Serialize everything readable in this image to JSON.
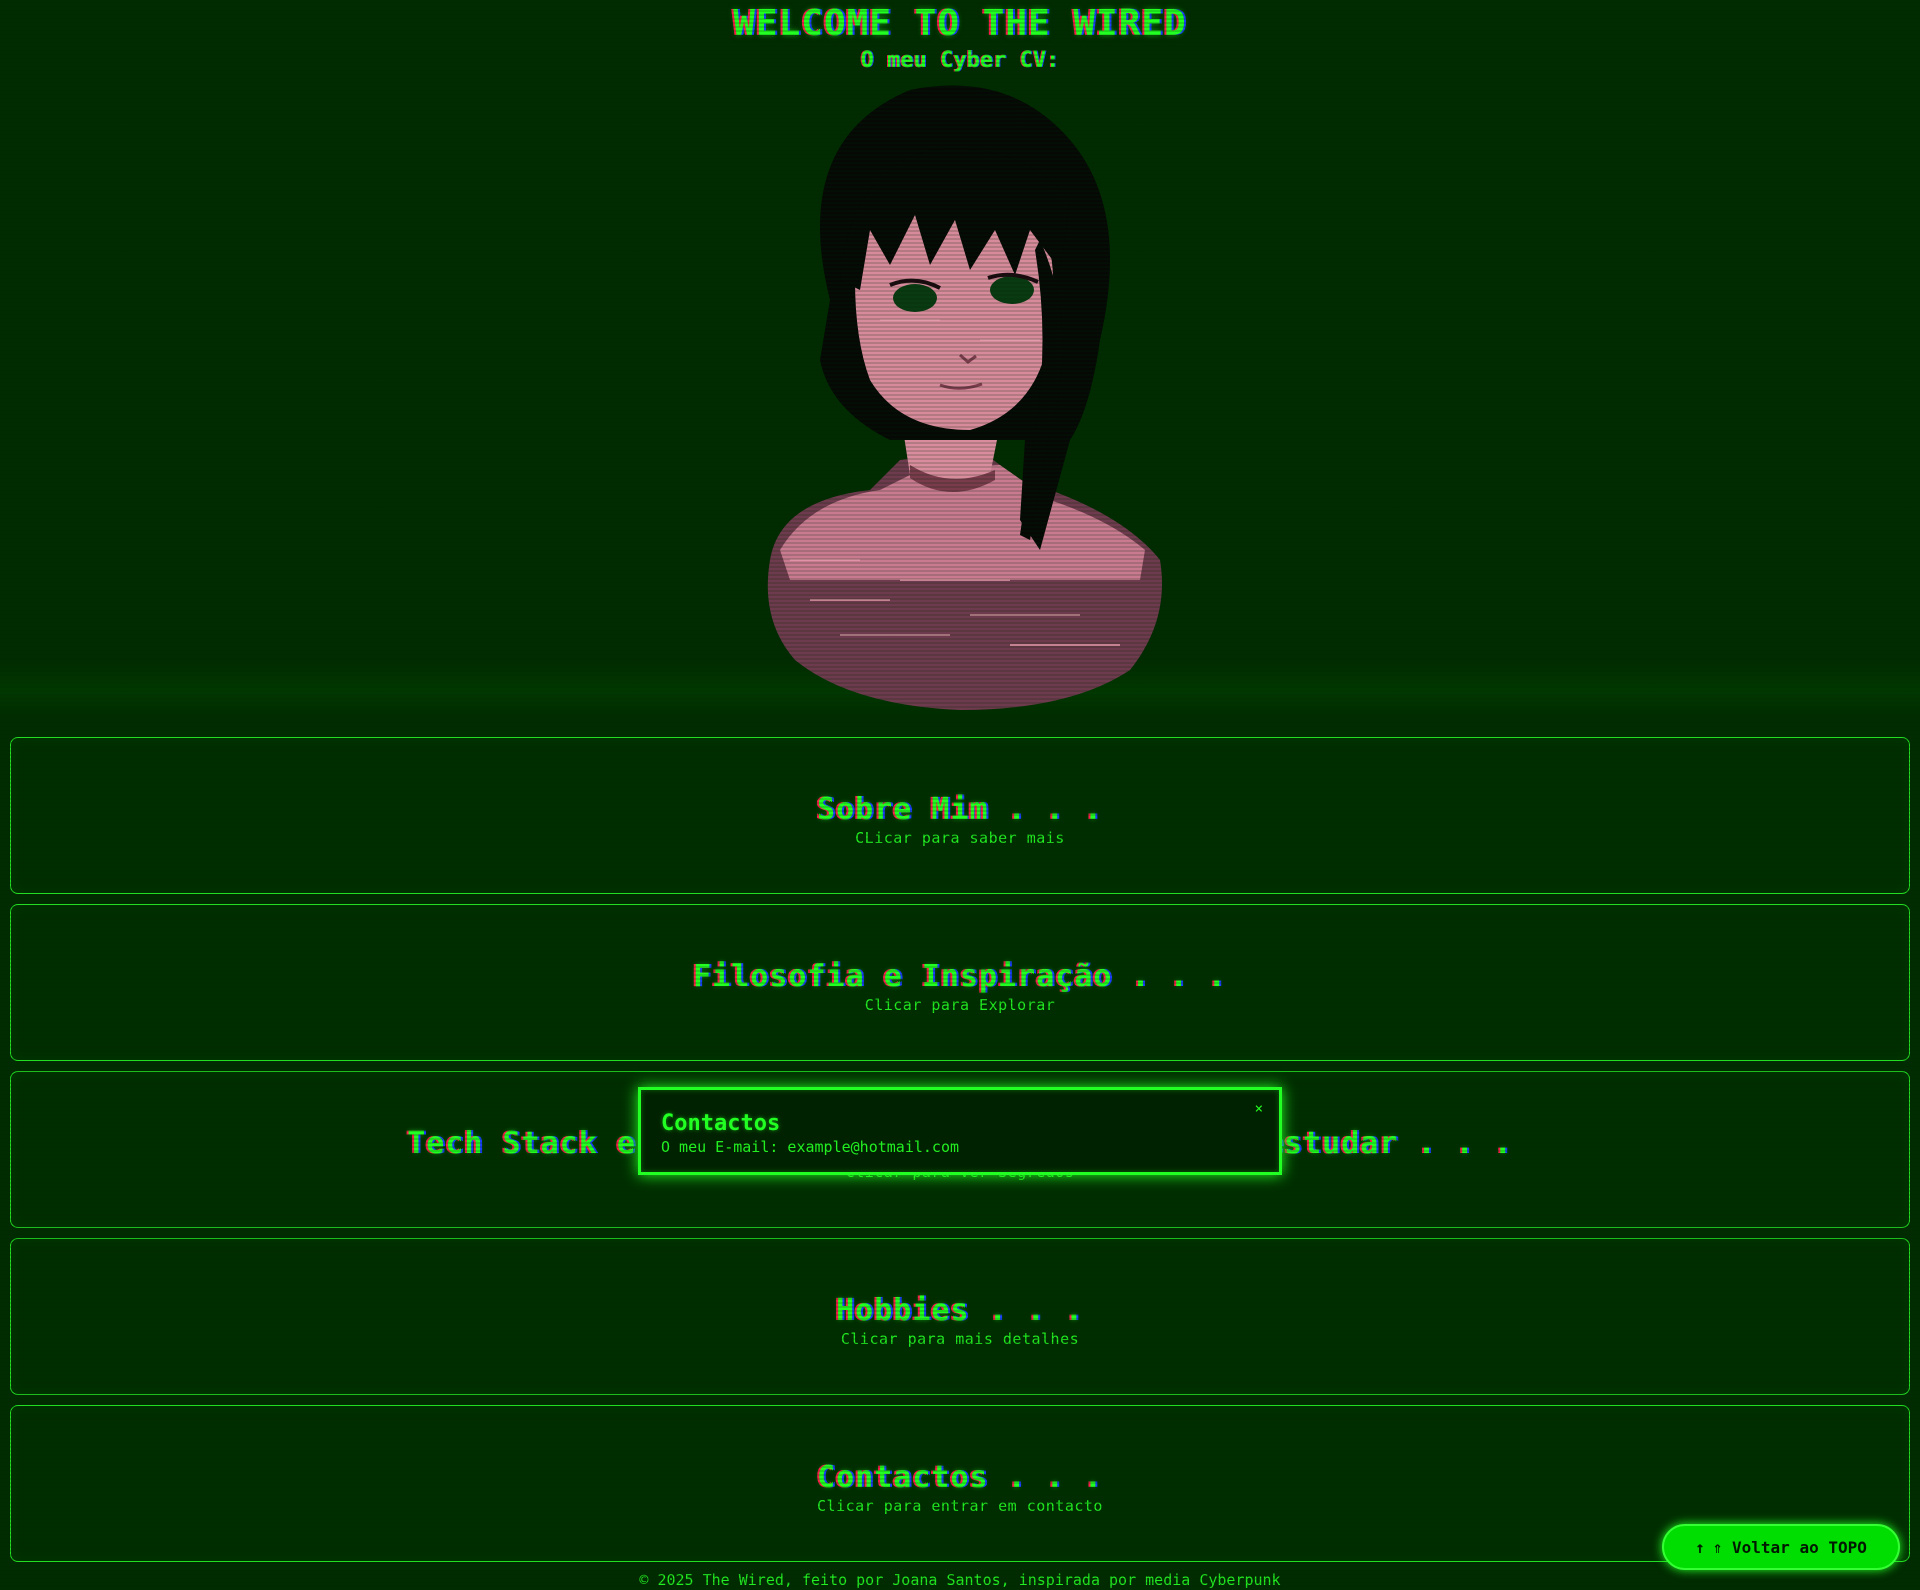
{
  "header": {
    "title": "WELCOME TO THE WIRED",
    "subtitle": "O meu Cyber CV:"
  },
  "sections": [
    {
      "title": "Sobre Mim . . .",
      "hint": "CLicar para saber mais"
    },
    {
      "title": "Filosofia e Inspiração . . .",
      "hint": "Clicar para Explorar"
    },
    {
      "title": "Tech Stack e Ferramentas que ando a usar e a estudar . . .",
      "hint": "Clicar para ver Segredos"
    },
    {
      "title": "Hobbies . . .",
      "hint": "Clicar para mais detalhes"
    },
    {
      "title": "Contactos . . .",
      "hint": "Clicar para entrar em contacto"
    }
  ],
  "modal": {
    "title": "Contactos",
    "text": "O meu E-mail: example@hotmail.com",
    "close_label": "×"
  },
  "top_button": {
    "icon": "↑",
    "label": "⇑ Voltar ao TOPO"
  },
  "footer": {
    "text": "© 2025 The Wired, feito por Joana Santos, inspirada por media Cyberpunk"
  },
  "colors": {
    "background": "#012b00",
    "accent": "#22ff22",
    "glitch_red": "#ff1a4a",
    "glitch_blue": "#1a3cff"
  }
}
